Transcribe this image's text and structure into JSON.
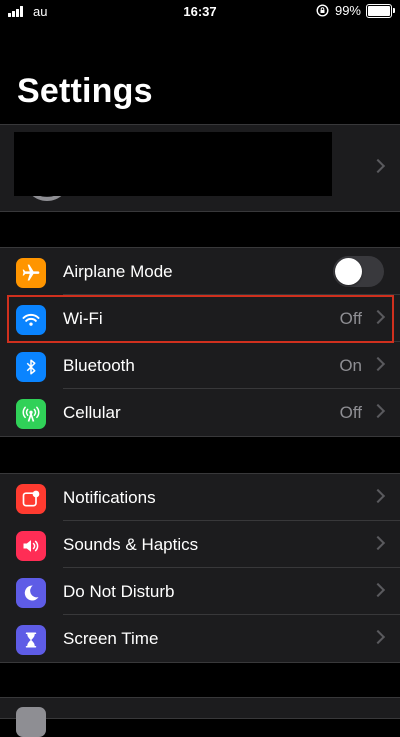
{
  "status_bar": {
    "carrier": "au",
    "time": "16:37",
    "battery": "99%"
  },
  "page": {
    "title": "Settings"
  },
  "connectivity": [
    {
      "label": "Airplane Mode",
      "icon": "airplane-icon",
      "color": "#ff9500",
      "toggle": false
    },
    {
      "label": "Wi-Fi",
      "value": "Off",
      "icon": "wifi-icon",
      "color": "#0a84ff"
    },
    {
      "label": "Bluetooth",
      "value": "On",
      "icon": "bluetooth-icon",
      "color": "#0a84ff"
    },
    {
      "label": "Cellular",
      "value": "Off",
      "icon": "cellular-icon",
      "color": "#30d158"
    }
  ],
  "notifications_group": [
    {
      "label": "Notifications",
      "icon": "notifications-icon",
      "color": "#ff3b30"
    },
    {
      "label": "Sounds & Haptics",
      "icon": "speaker-icon",
      "color": "#ff2d55"
    },
    {
      "label": "Do Not Disturb",
      "icon": "moon-icon",
      "color": "#5e5ce6"
    },
    {
      "label": "Screen Time",
      "icon": "hourglass-icon",
      "color": "#5e5ce6"
    }
  ],
  "highlight_color": "#d0301e"
}
